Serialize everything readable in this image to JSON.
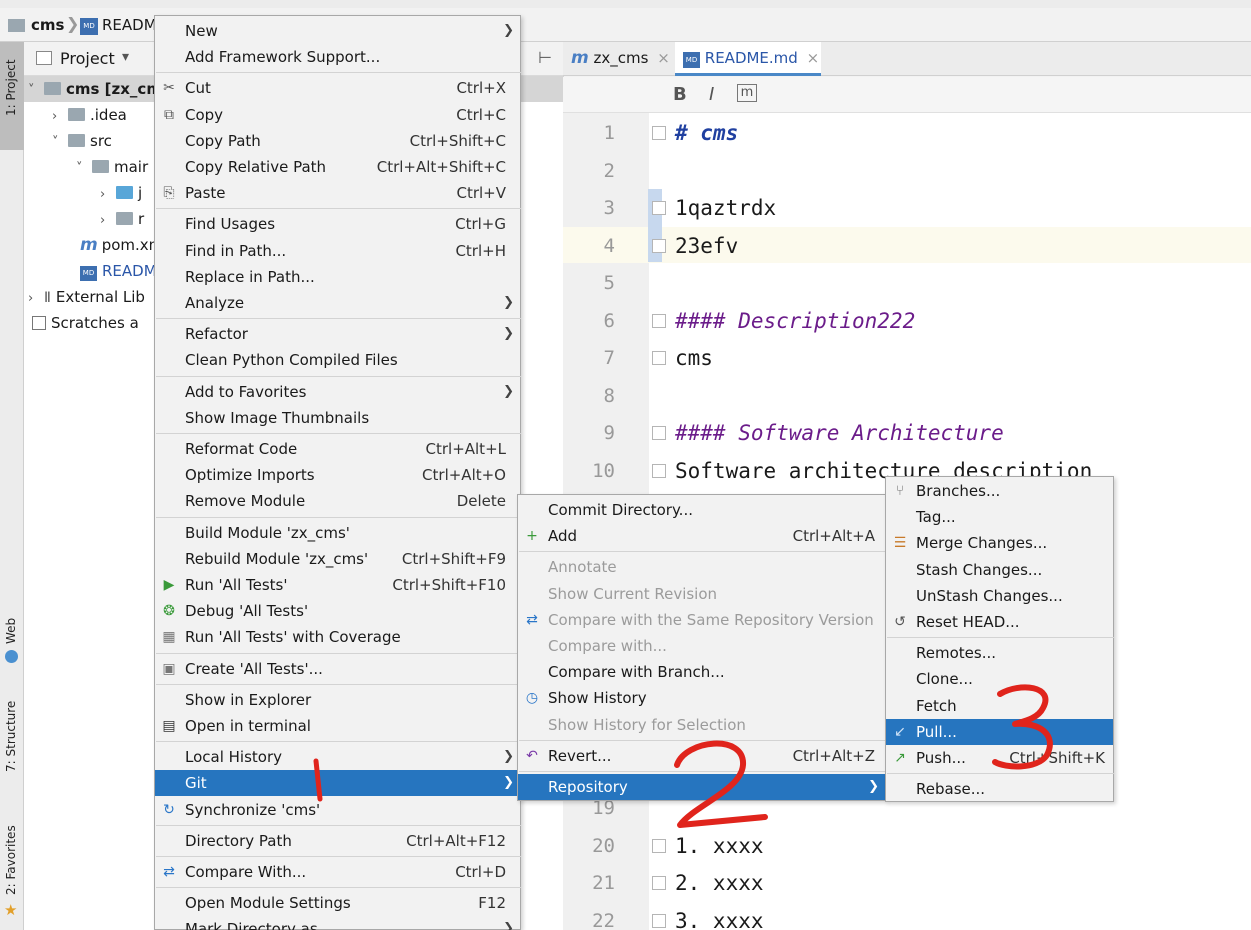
{
  "nav": {
    "crumb_project": "cms",
    "crumb_file": "READM",
    "md_badge": "MD",
    "separator": "❯"
  },
  "tool_windows": {
    "project": "1: Project",
    "web": "Web",
    "structure": "7: Structure",
    "favorites": "2: Favorites"
  },
  "project_panel": {
    "title": "Project",
    "dropdown": "▾",
    "tree": [
      {
        "label": "cms [zx_cm",
        "icon": "folder-icon",
        "arrow": "⌵",
        "bold": true
      },
      {
        "label": ".idea",
        "icon": "folder-icon",
        "arrow": "›"
      },
      {
        "label": "src",
        "icon": "folder-icon",
        "arrow": "⌵"
      },
      {
        "label": "mair",
        "icon": "folder-icon",
        "arrow": "⌵"
      },
      {
        "label": "j",
        "icon": "folder-icon",
        "arrow": "›"
      },
      {
        "label": "r",
        "icon": "folder-icon",
        "arrow": "›"
      },
      {
        "label": "pom.xm",
        "icon": "maven-icon"
      },
      {
        "label": "READM",
        "icon": "markdown-icon"
      },
      {
        "label": "External Lib",
        "icon": "library-icon",
        "arrow": "›"
      },
      {
        "label": "Scratches a",
        "icon": "scratches-icon"
      }
    ]
  },
  "editor": {
    "tabs": [
      {
        "label": "zx_cms",
        "icon": "maven-icon",
        "close": "×"
      },
      {
        "label": "README.md",
        "icon": "markdown-icon",
        "close": "×"
      }
    ],
    "toolbar": {
      "bold": "B",
      "italic": "I",
      "code": "m"
    },
    "lines": [
      {
        "n": "1",
        "text": "# cms",
        "style": "h1"
      },
      {
        "n": "2",
        "text": ""
      },
      {
        "n": "3",
        "text": "1qaztrdx"
      },
      {
        "n": "4",
        "text": "23efv"
      },
      {
        "n": "5",
        "text": ""
      },
      {
        "n": "6",
        "text": "#### Description222",
        "style": "h"
      },
      {
        "n": "7",
        "text": "cms"
      },
      {
        "n": "8",
        "text": ""
      },
      {
        "n": "9",
        "text": "#### Software Architecture",
        "style": "h"
      },
      {
        "n": "10",
        "text": "Software architecture description"
      },
      {
        "n": "19",
        "text": ""
      },
      {
        "n": "20",
        "text": "1.   xxxx"
      },
      {
        "n": "21",
        "text": "2.   xxxx"
      },
      {
        "n": "22",
        "text": "3.   xxxx"
      }
    ]
  },
  "context_menu": {
    "items": [
      {
        "label": "New",
        "submenu": true
      },
      {
        "label": "Add Framework Support..."
      },
      {
        "sep": true
      },
      {
        "label": "Cut",
        "shortcut": "Ctrl+X",
        "icon": "cut-icon"
      },
      {
        "label": "Copy",
        "shortcut": "Ctrl+C",
        "icon": "copy-icon"
      },
      {
        "label": "Copy Path",
        "shortcut": "Ctrl+Shift+C"
      },
      {
        "label": "Copy Relative Path",
        "shortcut": "Ctrl+Alt+Shift+C"
      },
      {
        "label": "Paste",
        "shortcut": "Ctrl+V",
        "icon": "paste-icon"
      },
      {
        "sep": true
      },
      {
        "label": "Find Usages",
        "shortcut": "Ctrl+G"
      },
      {
        "label": "Find in Path...",
        "shortcut": "Ctrl+H"
      },
      {
        "label": "Replace in Path..."
      },
      {
        "label": "Analyze",
        "submenu": true
      },
      {
        "sep": true
      },
      {
        "label": "Refactor",
        "submenu": true
      },
      {
        "label": "Clean Python Compiled Files"
      },
      {
        "sep": true
      },
      {
        "label": "Add to Favorites",
        "submenu": true
      },
      {
        "label": "Show Image Thumbnails"
      },
      {
        "sep": true
      },
      {
        "label": "Reformat Code",
        "shortcut": "Ctrl+Alt+L"
      },
      {
        "label": "Optimize Imports",
        "shortcut": "Ctrl+Alt+O"
      },
      {
        "label": "Remove Module",
        "shortcut": "Delete"
      },
      {
        "sep": true
      },
      {
        "label": "Build Module 'zx_cms'"
      },
      {
        "label": "Rebuild Module 'zx_cms'",
        "shortcut": "Ctrl+Shift+F9"
      },
      {
        "label": "Run 'All Tests'",
        "shortcut": "Ctrl+Shift+F10",
        "icon": "run-icon"
      },
      {
        "label": "Debug 'All Tests'",
        "icon": "debug-icon"
      },
      {
        "label": "Run 'All Tests' with Coverage",
        "icon": "coverage-icon"
      },
      {
        "sep": true
      },
      {
        "label": "Create 'All Tests'...",
        "icon": "test-config-icon"
      },
      {
        "sep": true
      },
      {
        "label": "Show in Explorer"
      },
      {
        "label": "Open in terminal",
        "icon": "terminal-icon"
      },
      {
        "sep": true
      },
      {
        "label": "Local History",
        "submenu": true
      },
      {
        "label": "Git",
        "submenu": true,
        "selected": true
      },
      {
        "label": "Synchronize 'cms'",
        "icon": "sync-icon"
      },
      {
        "sep": true
      },
      {
        "label": "Directory Path",
        "shortcut": "Ctrl+Alt+F12"
      },
      {
        "sep": true
      },
      {
        "label": "Compare With...",
        "shortcut": "Ctrl+D",
        "icon": "compare-icon"
      },
      {
        "sep": true
      },
      {
        "label": "Open Module Settings",
        "shortcut": "F12"
      },
      {
        "label": "Mark Directory as",
        "submenu": true
      }
    ]
  },
  "git_menu": {
    "items": [
      {
        "label": "Commit Directory..."
      },
      {
        "label": "Add",
        "shortcut": "Ctrl+Alt+A",
        "icon": "add-icon"
      },
      {
        "sep": true
      },
      {
        "label": "Annotate",
        "disabled": true
      },
      {
        "label": "Show Current Revision",
        "disabled": true
      },
      {
        "label": "Compare with the Same Repository Version",
        "disabled": true,
        "icon": "compare-icon"
      },
      {
        "label": "Compare with...",
        "disabled": true
      },
      {
        "label": "Compare with Branch..."
      },
      {
        "label": "Show History",
        "icon": "history-icon"
      },
      {
        "label": "Show History for Selection",
        "disabled": true
      },
      {
        "sep": true
      },
      {
        "label": "Revert...",
        "shortcut": "Ctrl+Alt+Z",
        "icon": "revert-icon"
      },
      {
        "sep": true
      },
      {
        "label": "Repository",
        "submenu": true,
        "selected": true
      }
    ]
  },
  "repo_menu": {
    "items": [
      {
        "label": "Branches...",
        "icon": "branch-icon"
      },
      {
        "label": "Tag..."
      },
      {
        "label": "Merge Changes...",
        "icon": "merge-icon"
      },
      {
        "label": "Stash Changes..."
      },
      {
        "label": "UnStash Changes..."
      },
      {
        "label": "Reset HEAD...",
        "icon": "reset-icon"
      },
      {
        "sep": true
      },
      {
        "label": "Remotes..."
      },
      {
        "label": "Clone..."
      },
      {
        "label": "Fetch"
      },
      {
        "label": "Pull...",
        "selected": true,
        "icon": "pull-icon"
      },
      {
        "label": "Push...",
        "shortcut": "Ctrl+Shift+K",
        "icon": "push-icon"
      },
      {
        "sep": true
      },
      {
        "label": "Rebase..."
      }
    ]
  },
  "annotations": {
    "step1": "1",
    "step2": "2",
    "step3": "3",
    "color": "#e0241c"
  },
  "colors": {
    "selection": "#2675bf",
    "menu_bg": "#f2f2f2",
    "heading": "#6b1c8a",
    "current_line": "#fcfaed"
  }
}
